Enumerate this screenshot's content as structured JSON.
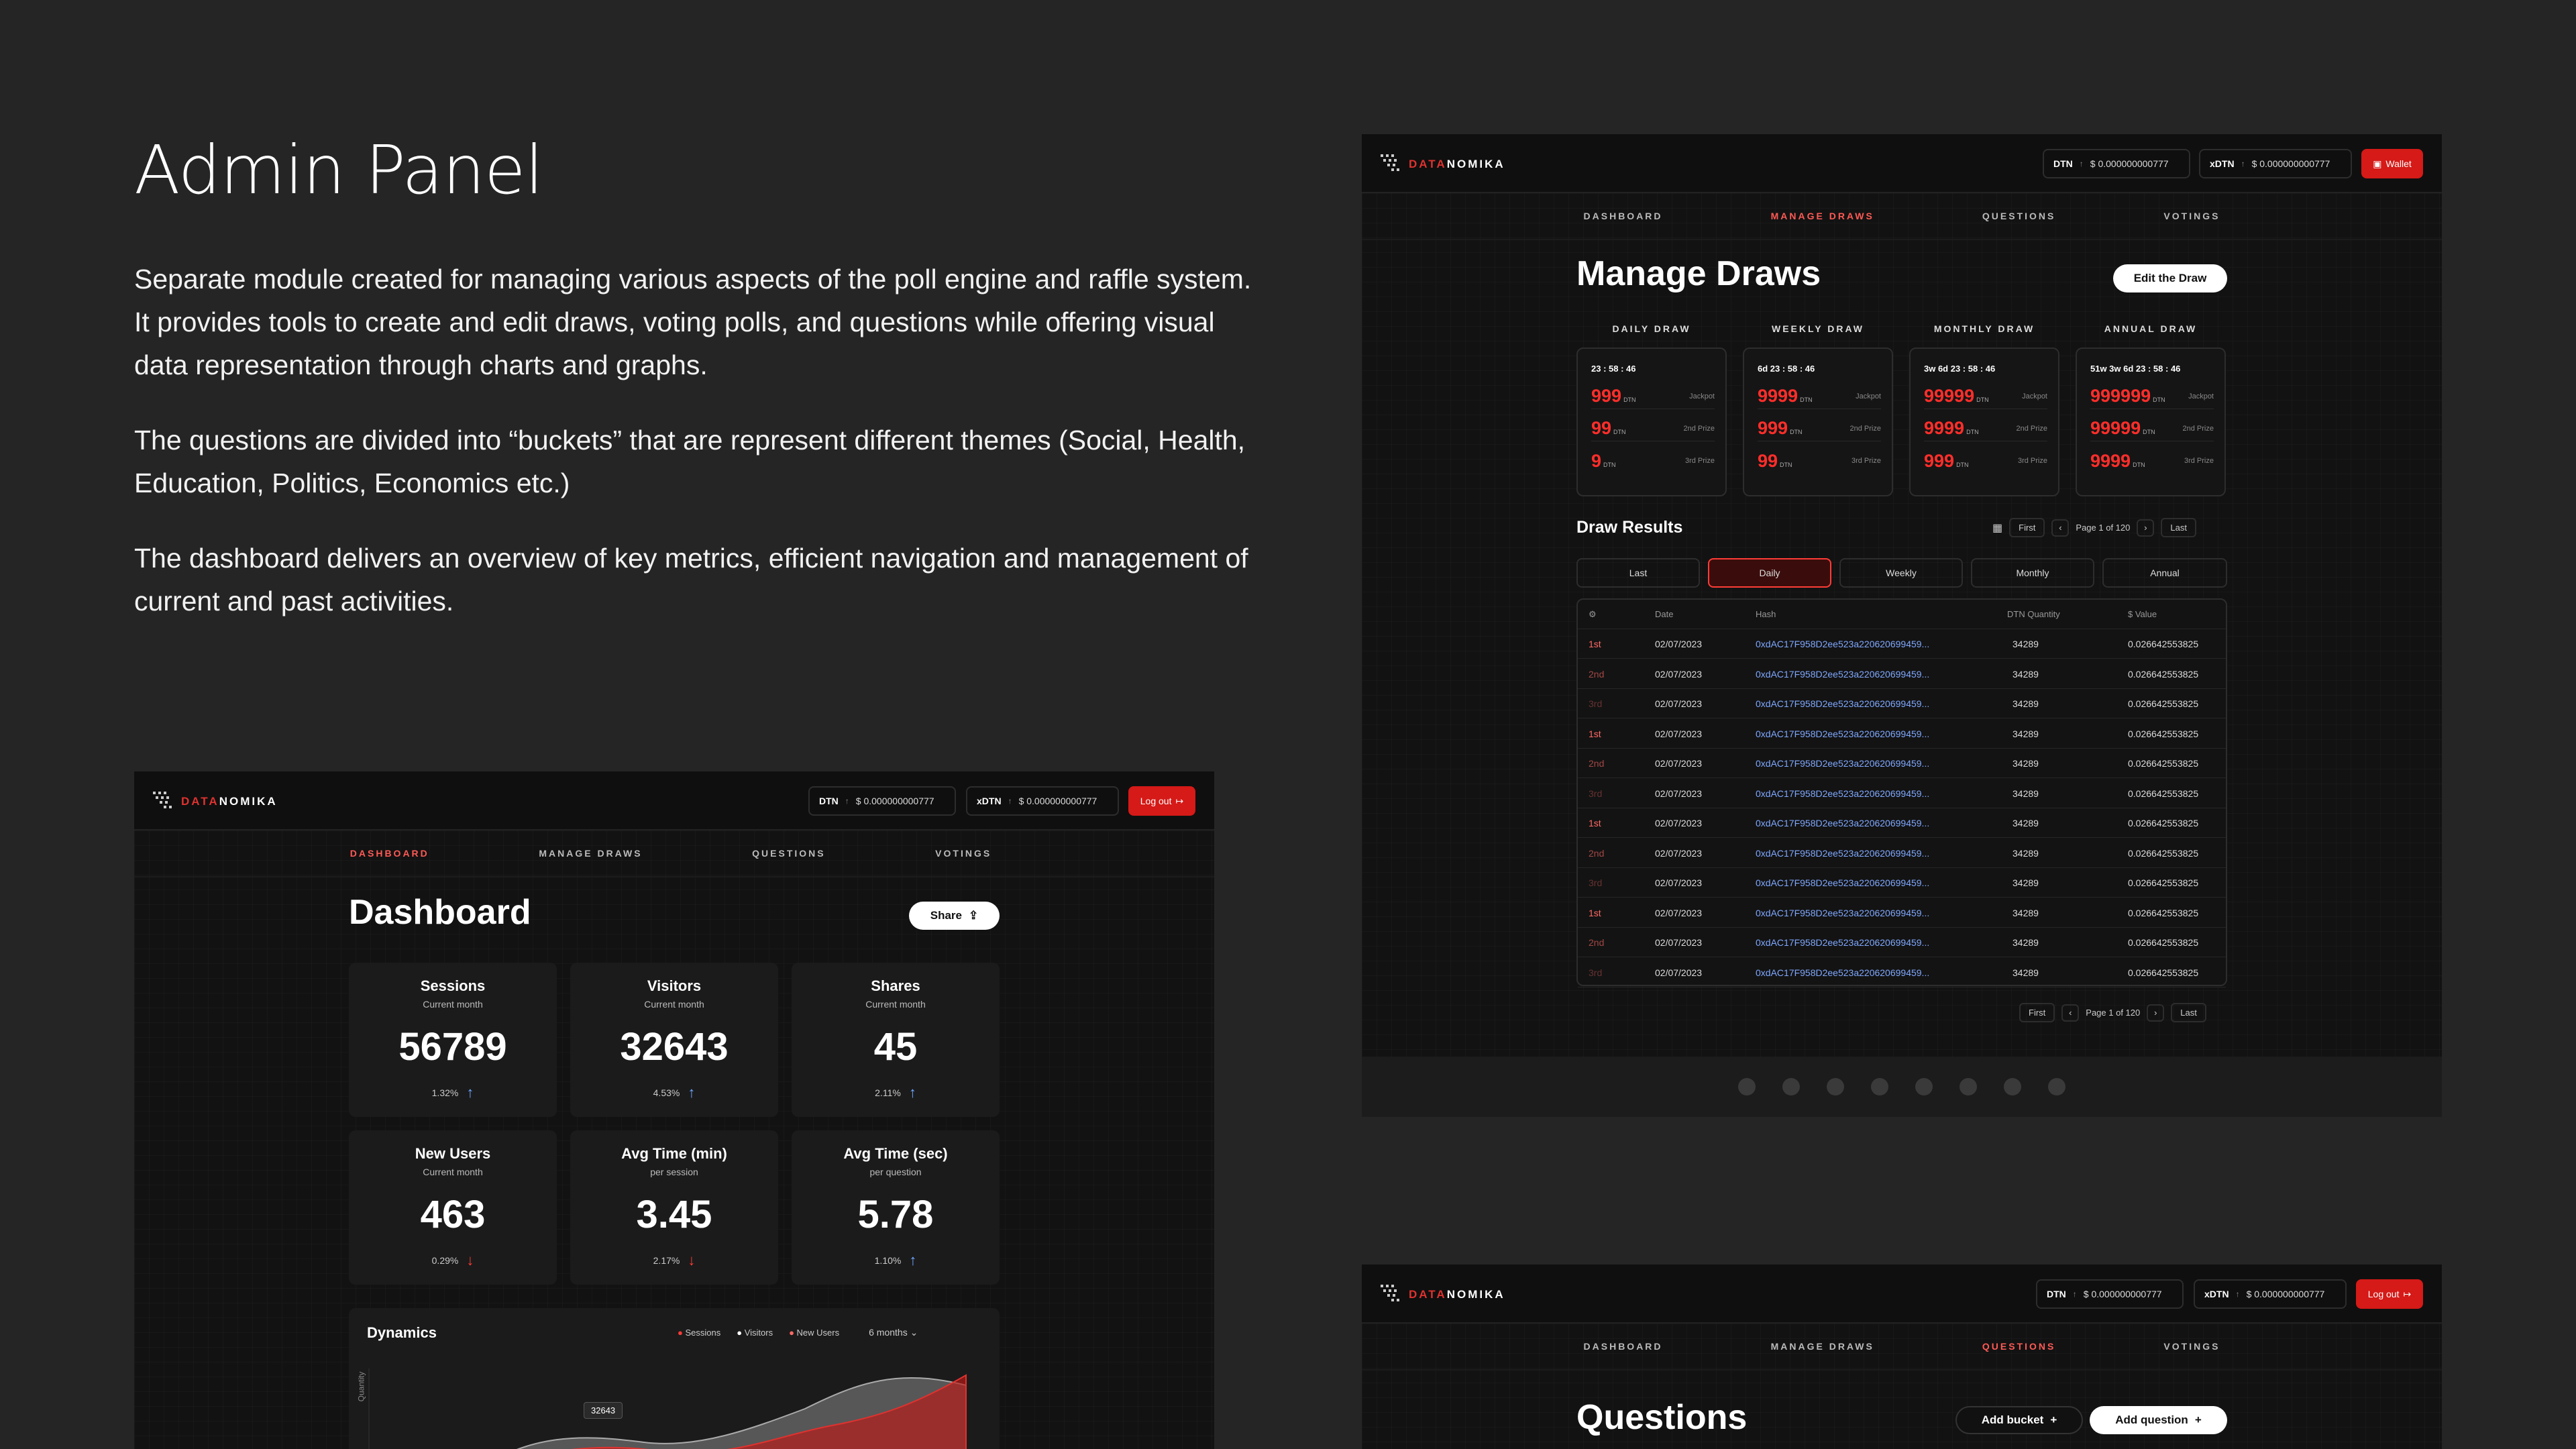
{
  "intro": {
    "title": "Admin Panel",
    "paragraphs": [
      "Separate module created for managing various aspects of the poll engine and raffle system. It provides tools to create and edit draws, voting polls, and questions while offering visual data representation through charts and graphs.",
      "The questions are divided into “buckets” that are represent different themes (Social, Health, Education, Politics, Economics etc.)",
      "The dashboard delivers an overview of key metrics, efficient navigation and management of current and past activities."
    ]
  },
  "brand": {
    "logo_red": "DATA",
    "logo_white": "NOMIKA",
    "accent": "#d51a17"
  },
  "tokens": {
    "dtn_label": "DTN",
    "dtn_value": "$ 0.000000000777",
    "xdtn_label": "xDTN",
    "xdtn_value": "$ 0.000000000777"
  },
  "nav": {
    "dashboard": "DASHBOARD",
    "manage_draws": "MANAGE DRAWS",
    "questions": "QUESTIONS",
    "votings": "VOTINGS"
  },
  "dashboard": {
    "logout": "Log out",
    "title": "Dashboard",
    "share": "Share",
    "cards": [
      {
        "title": "Sessions",
        "sub": "Current month",
        "value": "56789",
        "pct": "1.32%",
        "trend": "up"
      },
      {
        "title": "Visitors",
        "sub": "Current month",
        "value": "32643",
        "pct": "4.53%",
        "trend": "up"
      },
      {
        "title": "Shares",
        "sub": "Current month",
        "value": "45",
        "pct": "2.11%",
        "trend": "up"
      },
      {
        "title": "New Users",
        "sub": "Current month",
        "value": "463",
        "pct": "0.29%",
        "trend": "down"
      },
      {
        "title": "Avg Time (min)",
        "sub": "per session",
        "value": "3.45",
        "pct": "2.17%",
        "trend": "down"
      },
      {
        "title": "Avg Time (sec)",
        "sub": "per question",
        "value": "5.78",
        "pct": "1.10%",
        "trend": "up"
      }
    ],
    "dynamics": {
      "title": "Dynamics",
      "legend": [
        "Sessions",
        "Visitors",
        "New Users"
      ],
      "range": "6 months",
      "ylabel": "Quantity",
      "tooltip": "32643"
    }
  },
  "draws": {
    "wallet": "Wallet",
    "title": "Manage Draws",
    "edit": "Edit the Draw",
    "draw_unit": "DTN",
    "prize_labels": [
      "Jackpot",
      "2nd Prize",
      "3rd Prize"
    ],
    "columns": [
      {
        "label": "DAILY DRAW",
        "timer": "23 : 58 : 46",
        "values": [
          "999",
          "99",
          "9"
        ]
      },
      {
        "label": "WEEKLY DRAW",
        "timer": "6d  23 : 58 : 46",
        "values": [
          "9999",
          "999",
          "99"
        ]
      },
      {
        "label": "MONTHLY DRAW",
        "timer": "3w 6d  23 : 58 : 46",
        "values": [
          "99999",
          "9999",
          "999"
        ]
      },
      {
        "label": "ANNUAL DRAW",
        "timer": "51w 3w 6d  23 : 58 : 46",
        "values": [
          "999999",
          "99999",
          "9999"
        ]
      }
    ],
    "results_title": "Draw Results",
    "pager": {
      "first": "First",
      "page": "Page 1 of 120",
      "last": "Last"
    },
    "filters": [
      "Last",
      "Daily",
      "Weekly",
      "Monthly",
      "Annual"
    ],
    "table_headers": [
      "Date",
      "Hash",
      "DTN Quantity",
      "$ Value"
    ],
    "rows": [
      {
        "place": "1st",
        "date": "02/07/2023",
        "hash": "0xdAC17F958D2ee523a220620699459...",
        "qty": "34289",
        "value": "0.026642553825"
      },
      {
        "place": "2nd",
        "date": "02/07/2023",
        "hash": "0xdAC17F958D2ee523a220620699459...",
        "qty": "34289",
        "value": "0.026642553825"
      },
      {
        "place": "3rd",
        "date": "02/07/2023",
        "hash": "0xdAC17F958D2ee523a220620699459...",
        "qty": "34289",
        "value": "0.026642553825"
      },
      {
        "place": "1st",
        "date": "02/07/2023",
        "hash": "0xdAC17F958D2ee523a220620699459...",
        "qty": "34289",
        "value": "0.026642553825"
      },
      {
        "place": "2nd",
        "date": "02/07/2023",
        "hash": "0xdAC17F958D2ee523a220620699459...",
        "qty": "34289",
        "value": "0.026642553825"
      },
      {
        "place": "3rd",
        "date": "02/07/2023",
        "hash": "0xdAC17F958D2ee523a220620699459...",
        "qty": "34289",
        "value": "0.026642553825"
      },
      {
        "place": "1st",
        "date": "02/07/2023",
        "hash": "0xdAC17F958D2ee523a220620699459...",
        "qty": "34289",
        "value": "0.026642553825"
      },
      {
        "place": "2nd",
        "date": "02/07/2023",
        "hash": "0xdAC17F958D2ee523a220620699459...",
        "qty": "34289",
        "value": "0.026642553825"
      },
      {
        "place": "3rd",
        "date": "02/07/2023",
        "hash": "0xdAC17F958D2ee523a220620699459...",
        "qty": "34289",
        "value": "0.026642553825"
      },
      {
        "place": "1st",
        "date": "02/07/2023",
        "hash": "0xdAC17F958D2ee523a220620699459...",
        "qty": "34289",
        "value": "0.026642553825"
      },
      {
        "place": "2nd",
        "date": "02/07/2023",
        "hash": "0xdAC17F958D2ee523a220620699459...",
        "qty": "34289",
        "value": "0.026642553825"
      },
      {
        "place": "3rd",
        "date": "02/07/2023",
        "hash": "0xdAC17F958D2ee523a220620699459...",
        "qty": "34289",
        "value": "0.026642553825"
      }
    ]
  },
  "questions": {
    "logout": "Log out",
    "title": "Questions",
    "add_bucket": "Add bucket",
    "add_question": "Add question"
  }
}
